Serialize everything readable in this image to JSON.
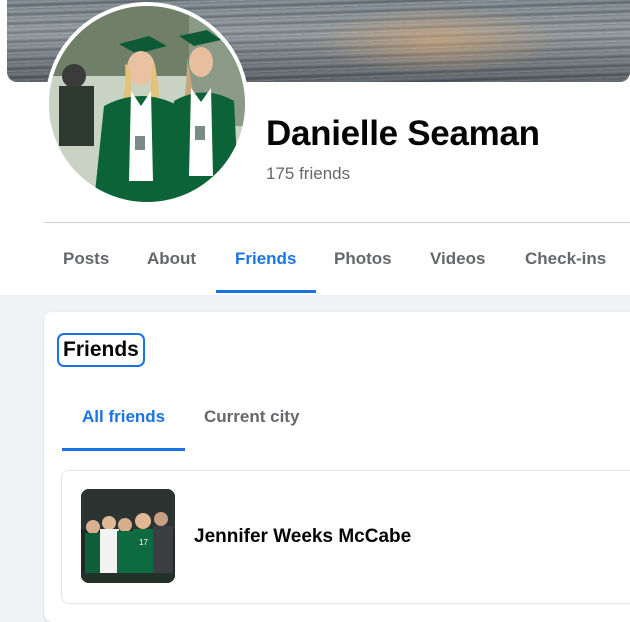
{
  "profile": {
    "name": "Danielle Seaman",
    "friends_count": "175 friends"
  },
  "tabs": [
    {
      "label": "Posts"
    },
    {
      "label": "About"
    },
    {
      "label": "Friends",
      "active": true
    },
    {
      "label": "Photos"
    },
    {
      "label": "Videos"
    },
    {
      "label": "Check-ins"
    }
  ],
  "friends_section": {
    "title": "Friends",
    "subtabs": [
      {
        "label": "All friends",
        "active": true
      },
      {
        "label": "Current city"
      }
    ],
    "friends": [
      {
        "name": "Jennifer Weeks McCabe"
      }
    ]
  },
  "colors": {
    "accent": "#1b74e4",
    "page_bg": "#f0f2f5",
    "secondary_text": "#65676b"
  }
}
